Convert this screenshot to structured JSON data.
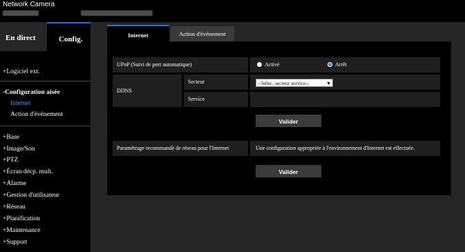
{
  "header": {
    "brand": "Network Camera"
  },
  "nav": {
    "tab_live": "En direct",
    "tab_config": "Config."
  },
  "sidebar": {
    "ext_software": "+Logiciel ext.",
    "easy_setup": "-Configuration aisée",
    "sub_internet": "Internet",
    "sub_event": "Action d'événement",
    "items": [
      "+Base",
      "+Image/Son",
      "+PTZ",
      "+Écran décp. mult.",
      "+Alarme",
      "+Gestion d'utilisateur",
      "+Réseau",
      "+Planification",
      "+Maintenance",
      "+Support"
    ]
  },
  "page_tabs": {
    "internet": "Internet",
    "event_action": "Action d'événement"
  },
  "form": {
    "upnp_label": "UPnP (Suivi de port automatique)",
    "upnp_on": "Activé",
    "upnp_off": "Arrêt",
    "upnp_selected": "Arrêt",
    "ddns_label": "DDNS",
    "sector_label": "Secteur",
    "sector_value": "--Sélec. secteur service--",
    "service_label": "Service",
    "apply_label_1": "Valider",
    "recommended_label": "Paramétrage recommandé de réseau pour l'Internet",
    "recommended_desc": "Une configuration appropriée à l'environnement d'Internet est effectuée.",
    "apply_label_2": "Valider"
  },
  "colors": {
    "accent": "#2f6fd8",
    "active_link": "#5d8fe6",
    "panel_bg": "#000000",
    "cell_bg": "#1f1f1f"
  }
}
